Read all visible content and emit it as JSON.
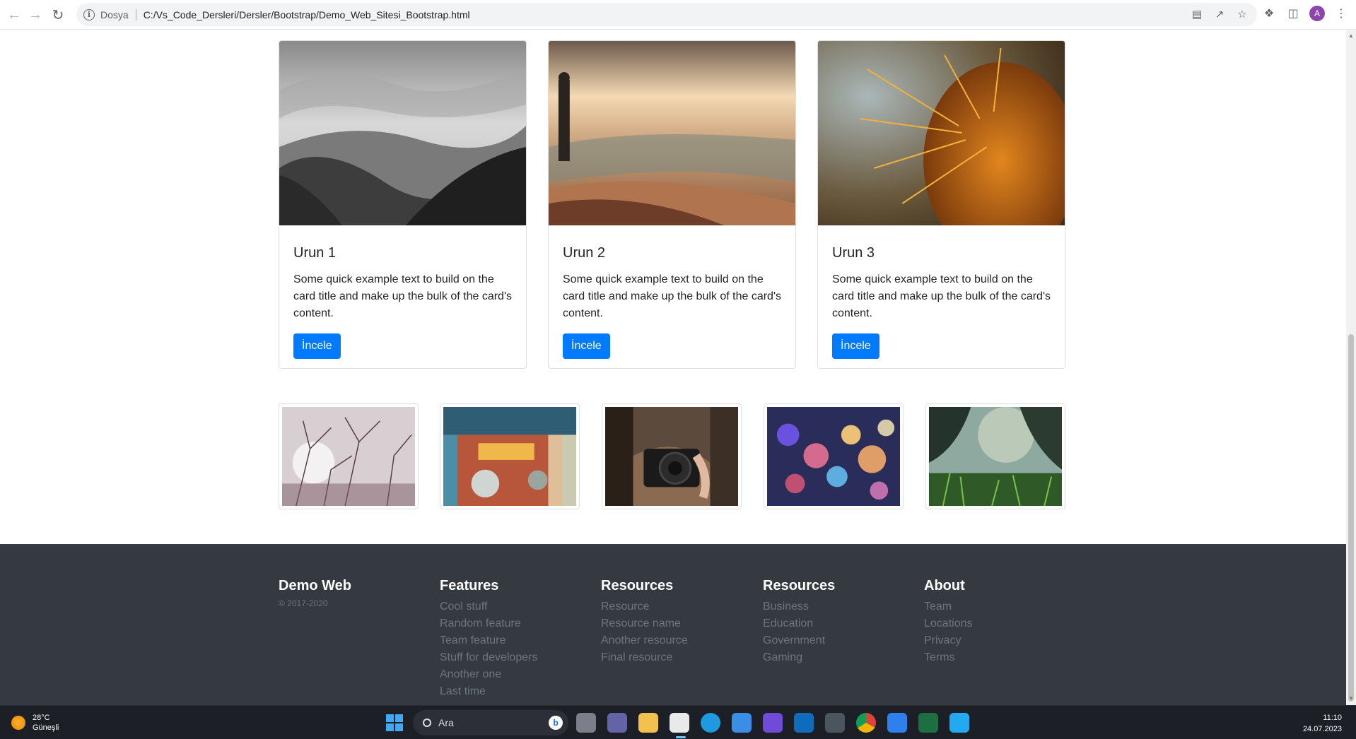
{
  "browser": {
    "scheme_label": "Dosya",
    "url": "C:/Vs_Code_Dersleri/Dersler/Bootstrap/Demo_Web_Sitesi_Bootstrap.html",
    "profile_initial": "A"
  },
  "cards": [
    {
      "title": "Urun 1",
      "text": "Some quick example text to build on the card title and make up the bulk of the card's content.",
      "button": "İncele"
    },
    {
      "title": "Urun 2",
      "text": "Some quick example text to build on the card title and make up the bulk of the card's content.",
      "button": "İncele"
    },
    {
      "title": "Urun 3",
      "text": "Some quick example text to build on the card title and make up the bulk of the card's content.",
      "button": "İncele"
    }
  ],
  "footer": {
    "brand": "Demo Web",
    "copyright": "© 2017-2020",
    "columns": [
      {
        "title": "Features",
        "links": [
          "Cool stuff",
          "Random feature",
          "Team feature",
          "Stuff for developers",
          "Another one",
          "Last time"
        ]
      },
      {
        "title": "Resources",
        "links": [
          "Resource",
          "Resource name",
          "Another resource",
          "Final resource"
        ]
      },
      {
        "title": "Resources",
        "links": [
          "Business",
          "Education",
          "Government",
          "Gaming"
        ]
      },
      {
        "title": "About",
        "links": [
          "Team",
          "Locations",
          "Privacy",
          "Terms"
        ]
      }
    ]
  },
  "taskbar": {
    "temperature": "28°C",
    "weather": "Güneşli",
    "search_placeholder": "Ara",
    "time": "11:10",
    "date": "24.07.2023"
  },
  "colors": {
    "primary": "#007bff",
    "footer_bg": "#343a40",
    "muted": "#6c757d"
  }
}
